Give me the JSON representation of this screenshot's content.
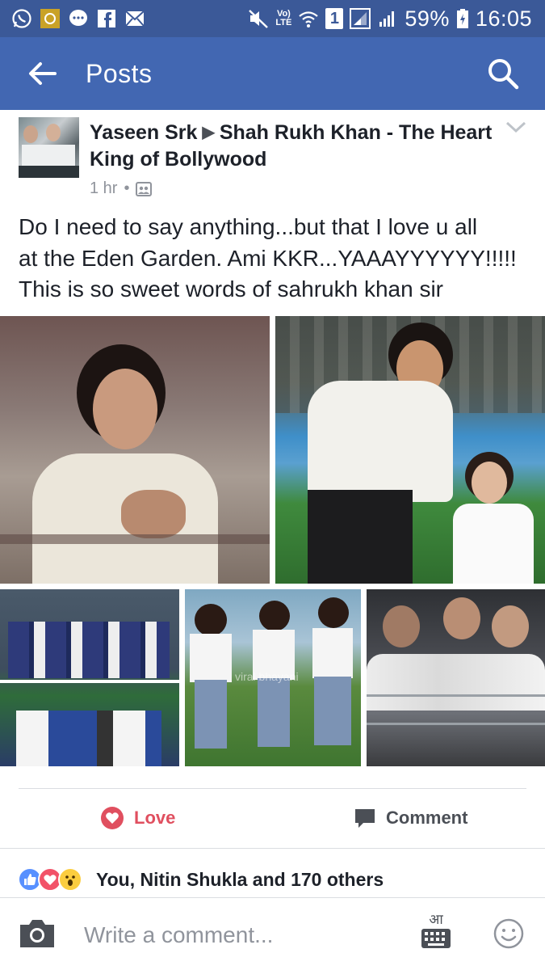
{
  "status_bar": {
    "battery": "59%",
    "time": "16:05",
    "volte_top": "Vo)",
    "volte_bottom": "LTE",
    "sim_badge": "1"
  },
  "app_bar": {
    "title": "Posts"
  },
  "post": {
    "author": "Yaseen Srk",
    "target_page": "Shah Rukh Khan - The Heart King of Bollywood",
    "time": "1 hr",
    "text_line_1": "Do I need to say anything...but that I love u all",
    "text_line_2": "at the Eden Garden. Ami KKR...YAAAYYYYYY!!!!!",
    "text_line_3": "This is so sweet  words  of sahrukh khan sir",
    "photo_watermark": "viral bhayani"
  },
  "actions": {
    "love_label": "Love",
    "comment_label": "Comment"
  },
  "reactions": {
    "summary": "You, Nitin Shukla and 170 others"
  },
  "comment_bar": {
    "placeholder": "Write a comment...",
    "keyboard_label": "आ"
  },
  "colors": {
    "status_bar": "#3b5998",
    "app_bar": "#4267b2",
    "love": "#e04f5f",
    "like": "#5890ff"
  }
}
